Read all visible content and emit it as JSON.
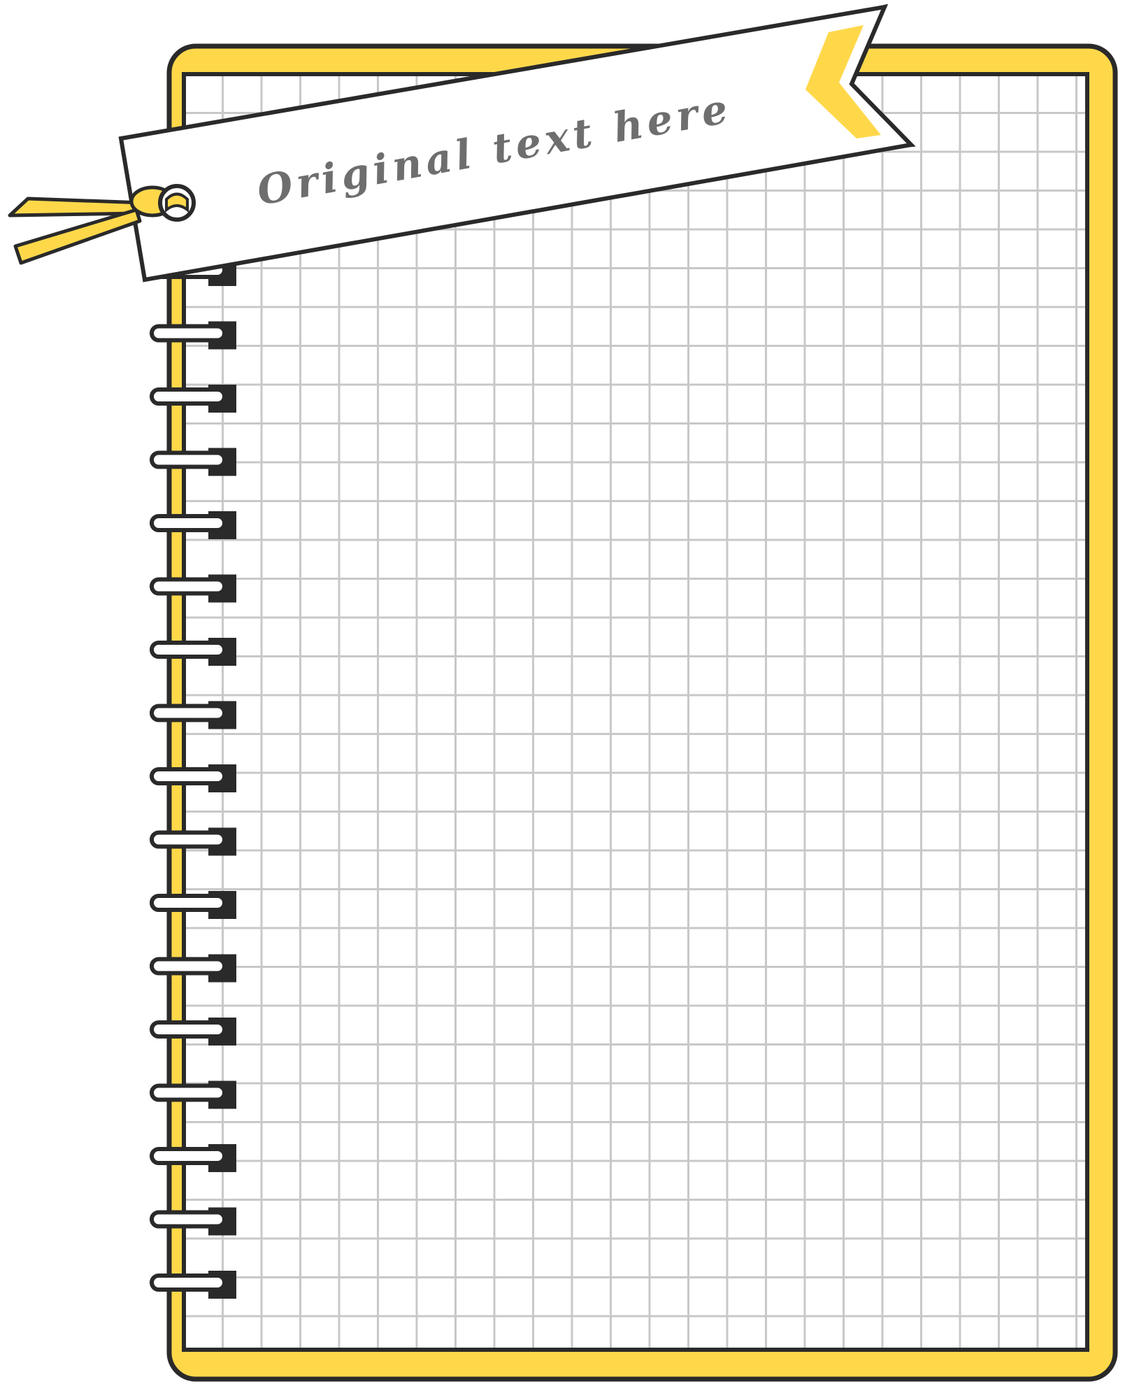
{
  "tag": {
    "text": "Original text here"
  },
  "notebook": {
    "spiral_ring_count": 17
  },
  "colors": {
    "cover": "#FFD84A",
    "outline": "#2a2a2a",
    "paper": "#ffffff",
    "grid": "#c8c8c8",
    "tag_text": "#6e6e6e"
  },
  "icons": {
    "ribbon": "ribbon-icon",
    "tag_hole": "tag-hole-icon",
    "spiral_ring": "spiral-ring-icon"
  }
}
